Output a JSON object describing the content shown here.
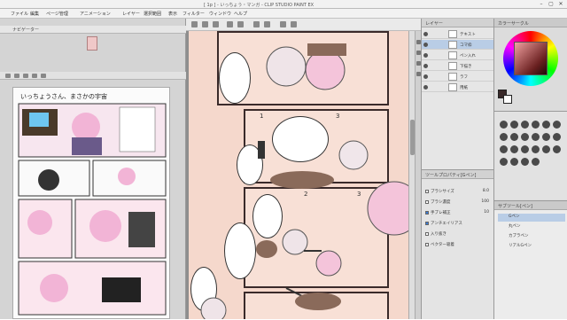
{
  "app": {
    "title": "[ 1p ] - いっちょう・マンガ - CLIP STUDIO PAINT EX",
    "window_controls": [
      "–",
      "▢",
      "✕"
    ]
  },
  "menu": {
    "items": [
      "ファイル",
      "編集",
      "ページ管理",
      "アニメーション",
      "レイヤー",
      "選択範囲",
      "表示",
      "フィルター",
      "ウィンドウ",
      "ヘルプ"
    ]
  },
  "navigator": {
    "tab_label": "ナビゲーター",
    "page_heading": "いっちょうさん、まさかの宇宙"
  },
  "layers": {
    "header": "レイヤー",
    "rows": [
      {
        "name": "テキスト",
        "selected": false
      },
      {
        "name": "コマ枠",
        "selected": true
      },
      {
        "name": "ペン入れ",
        "selected": false
      },
      {
        "name": "下描き",
        "selected": false
      },
      {
        "name": "ラフ",
        "selected": false
      },
      {
        "name": "用紙",
        "selected": false
      }
    ]
  },
  "tool_property": {
    "header": "ツールプロパティ[Gペン]",
    "rows": [
      {
        "label": "ブラシサイズ",
        "value": "8.0",
        "checked": false
      },
      {
        "label": "ブラシ濃度",
        "value": "100",
        "checked": false
      },
      {
        "label": "手ブレ補正",
        "value": "10",
        "checked": true
      },
      {
        "label": "アンチエイリアス",
        "value": "",
        "checked": true
      },
      {
        "label": "入り抜き",
        "value": "",
        "checked": false
      },
      {
        "label": "ベクター吸着",
        "value": "",
        "checked": false
      }
    ]
  },
  "colors": {
    "header": "カラーサークル",
    "main_color": "#3a2a2a",
    "sub_color": "#ffffff"
  },
  "subtool": {
    "header": "サブツール[ペン]",
    "items": [
      "Gペン",
      "丸ペン",
      "カブラペン",
      "リアルGペン"
    ]
  }
}
